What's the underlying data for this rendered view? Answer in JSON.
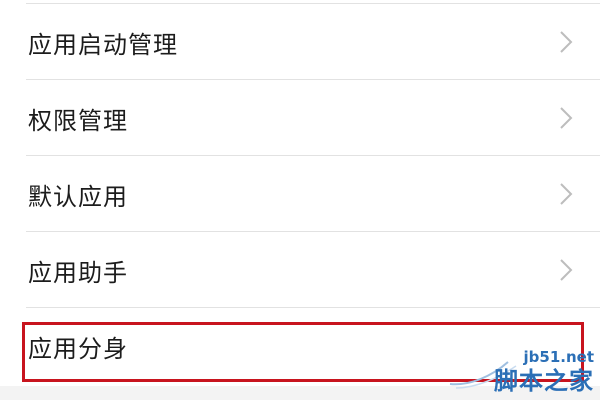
{
  "menu": {
    "items": [
      {
        "label": "应用启动管理",
        "icon": "chevron-right-icon",
        "show_chevron": true
      },
      {
        "label": "权限管理",
        "icon": "chevron-right-icon",
        "show_chevron": true
      },
      {
        "label": "默认应用",
        "icon": "chevron-right-icon",
        "show_chevron": true
      },
      {
        "label": "应用助手",
        "icon": "chevron-right-icon",
        "show_chevron": true
      },
      {
        "label": "应用分身",
        "icon": "chevron-right-icon",
        "show_chevron": false
      }
    ]
  },
  "highlight": {
    "target": "应用分身",
    "color": "#c8141e"
  },
  "watermark": {
    "site": "jb51.net",
    "name": "脚本之家",
    "color": "#2b6fb6"
  },
  "colors": {
    "text": "#1c1c1c",
    "divider": "#e2e2e2",
    "chevron": "#bdbdbd"
  }
}
